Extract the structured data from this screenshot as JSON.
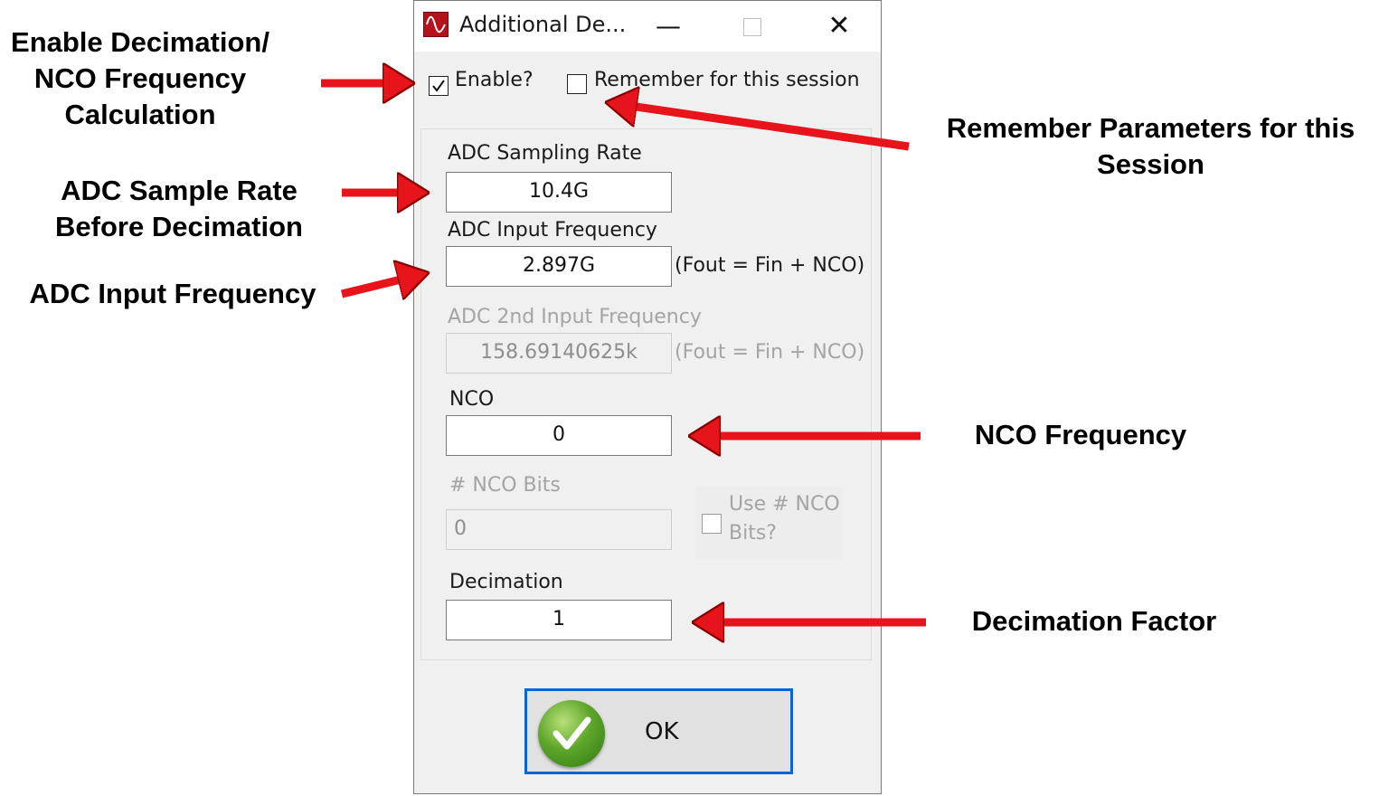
{
  "window": {
    "title": "Additional De...",
    "controls": {
      "minimize": "—",
      "close": "✕"
    }
  },
  "enable_checkbox": {
    "label": "Enable?",
    "checked": true
  },
  "remember_checkbox": {
    "label": "Remember for this session",
    "checked": false
  },
  "fields": {
    "adc_sampling_rate": {
      "label": "ADC Sampling Rate",
      "value": "10.4G"
    },
    "adc_input_frequency": {
      "label": "ADC Input  Frequency",
      "value": "2.897G",
      "suffix": "(Fout = Fin + NCO)"
    },
    "adc_2nd_input_frequency": {
      "label": "ADC 2nd Input  Frequency",
      "value": "158.69140625k",
      "suffix": "(Fout = Fin + NCO)",
      "disabled": true
    },
    "nco": {
      "label": "NCO",
      "value": "0"
    },
    "nco_bits": {
      "label": "# NCO Bits",
      "value": "0",
      "disabled": true
    },
    "use_nco_bits": {
      "label_line1": "Use # NCO",
      "label_line2": "Bits?",
      "checked": false,
      "disabled": true
    },
    "decimation": {
      "label": "Decimation",
      "value": "1"
    }
  },
  "ok_button": {
    "label": "OK",
    "icon": "checkmark-icon"
  },
  "annotations": {
    "enable": {
      "line1": "Enable Decimation/",
      "line2": "NCO Frequency",
      "line3": "Calculation"
    },
    "remember": {
      "line1": "Remember Parameters for this",
      "line2": "Session"
    },
    "sample_rate": {
      "line1": "ADC Sample Rate",
      "line2": "Before Decimation"
    },
    "input_frequency": {
      "line1": "ADC Input Frequency"
    },
    "nco_frequency": {
      "line1": "NCO Frequency"
    },
    "decimation_factor": {
      "line1": "Decimation Factor"
    }
  },
  "colors": {
    "arrow": "#e8141c",
    "focus_border": "#0a64d6",
    "disabled_text": "#a4a4a4"
  }
}
